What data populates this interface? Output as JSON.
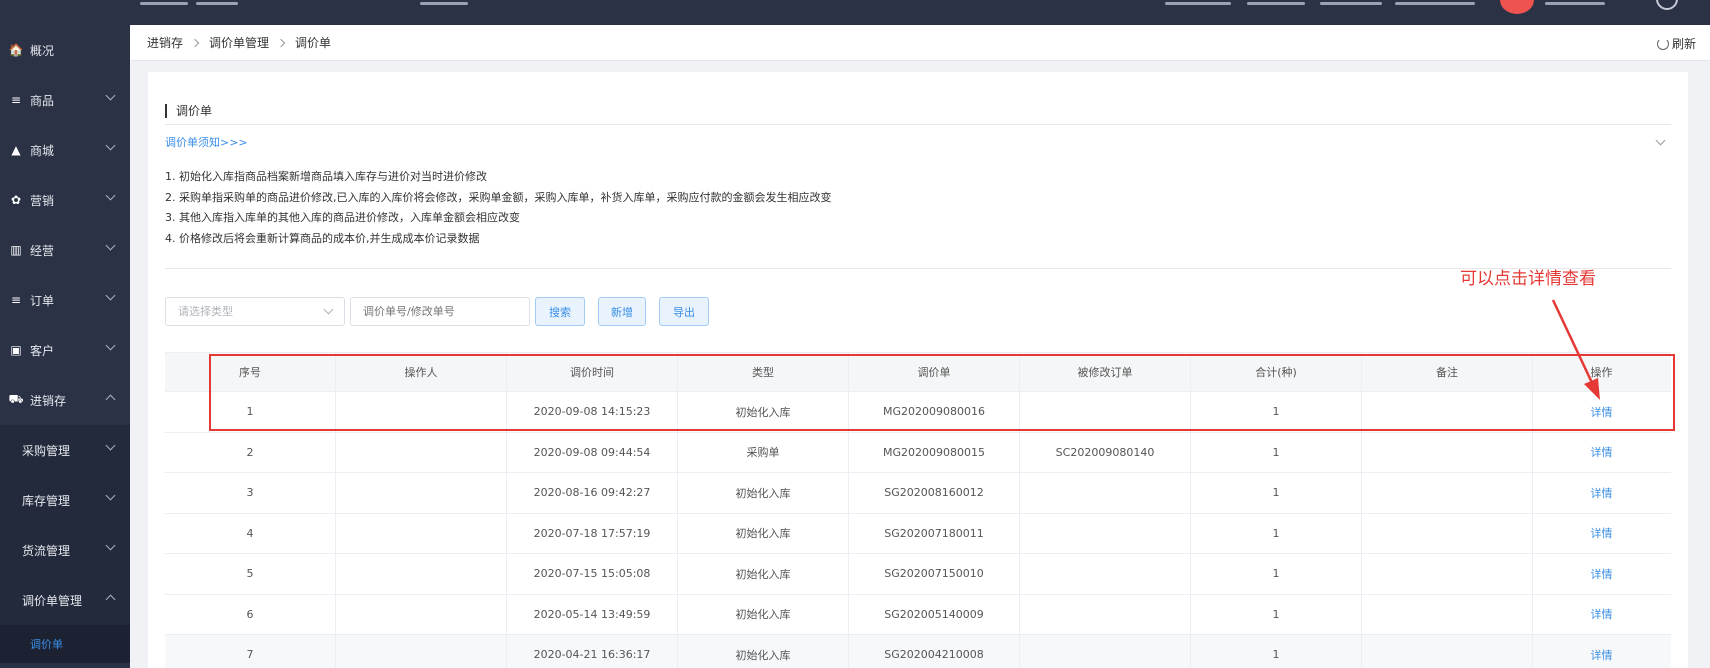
{
  "sidebar": {
    "items": [
      {
        "icon": "home-icon",
        "glyph": "🏠",
        "label": "概况",
        "has_chevron": false
      },
      {
        "icon": "list-icon",
        "glyph": "≡",
        "label": "商品",
        "has_chevron": true
      },
      {
        "icon": "bag-icon",
        "glyph": "▲",
        "label": "商城",
        "has_chevron": true
      },
      {
        "icon": "gift-icon",
        "glyph": "✿",
        "label": "营销",
        "has_chevron": true
      },
      {
        "icon": "chart-icon",
        "glyph": "▥",
        "label": "经营",
        "has_chevron": true
      },
      {
        "icon": "list-icon",
        "glyph": "≡",
        "label": "订单",
        "has_chevron": true
      },
      {
        "icon": "id-card-icon",
        "glyph": "▣",
        "label": "客户",
        "has_chevron": true
      },
      {
        "icon": "truck-icon",
        "glyph": "⛟",
        "label": "进销存",
        "has_chevron": true,
        "expanded": true
      }
    ],
    "sub_items": [
      {
        "label": "采购管理",
        "expanded": false
      },
      {
        "label": "库存管理",
        "expanded": false
      },
      {
        "label": "货流管理",
        "expanded": false
      },
      {
        "label": "调价单管理",
        "expanded": true
      }
    ],
    "active_leaf": "调价单"
  },
  "breadcrumb": [
    "进销存",
    "调价单管理",
    "调价单"
  ],
  "refresh_label": "刷新",
  "page": {
    "title": "调价单",
    "notice_link": "调价单须知>>>",
    "notes": [
      "1. 初始化入库指商品档案新增商品填入库存与进价对当时进价修改",
      "2. 采购单指采购单的商品进价修改,已入库的入库价将会修改，采购单金额，采购入库单，补货入库单，采购应付款的金额会发生相应改变",
      "3. 其他入库指入库单的其他入库的商品进价修改，入库单金额会相应改变",
      "4. 价格修改后将会重新计算商品的成本价,并生成成本价记录数据"
    ]
  },
  "filters": {
    "type_placeholder": "请选择类型",
    "order_placeholder": "调价单号/修改单号",
    "search_label": "搜索",
    "add_label": "新增",
    "export_label": "导出"
  },
  "table": {
    "columns": [
      "序号",
      "操作人",
      "调价时间",
      "类型",
      "调价单",
      "被修改订单",
      "合计(种)",
      "备注",
      "操作"
    ],
    "rows": [
      [
        "1",
        "",
        "2020-09-08 14:15:23",
        "初始化入库",
        "MG202009080016",
        "",
        "1",
        "",
        "详情"
      ],
      [
        "2",
        "",
        "2020-09-08 09:44:54",
        "采购单",
        "MG202009080015",
        "SC202009080140",
        "1",
        "",
        "详情"
      ],
      [
        "3",
        "",
        "2020-08-16 09:42:27",
        "初始化入库",
        "SG202008160012",
        "",
        "1",
        "",
        "详情"
      ],
      [
        "4",
        "",
        "2020-07-18 17:57:19",
        "初始化入库",
        "SG202007180011",
        "",
        "1",
        "",
        "详情"
      ],
      [
        "5",
        "",
        "2020-07-15 15:05:08",
        "初始化入库",
        "SG202007150010",
        "",
        "1",
        "",
        "详情"
      ],
      [
        "6",
        "",
        "2020-05-14 13:49:59",
        "初始化入库",
        "SG202005140009",
        "",
        "1",
        "",
        "详情"
      ],
      [
        "7",
        "",
        "2020-04-21 16:36:17",
        "初始化入库",
        "SG202004210008",
        "",
        "1",
        "",
        "详情"
      ]
    ]
  },
  "annotation": {
    "text": "可以点击详情查看",
    "color": "#e53935"
  },
  "colors": {
    "sidebar_bg": "#2b3245",
    "accent": "#3a8ee6"
  }
}
